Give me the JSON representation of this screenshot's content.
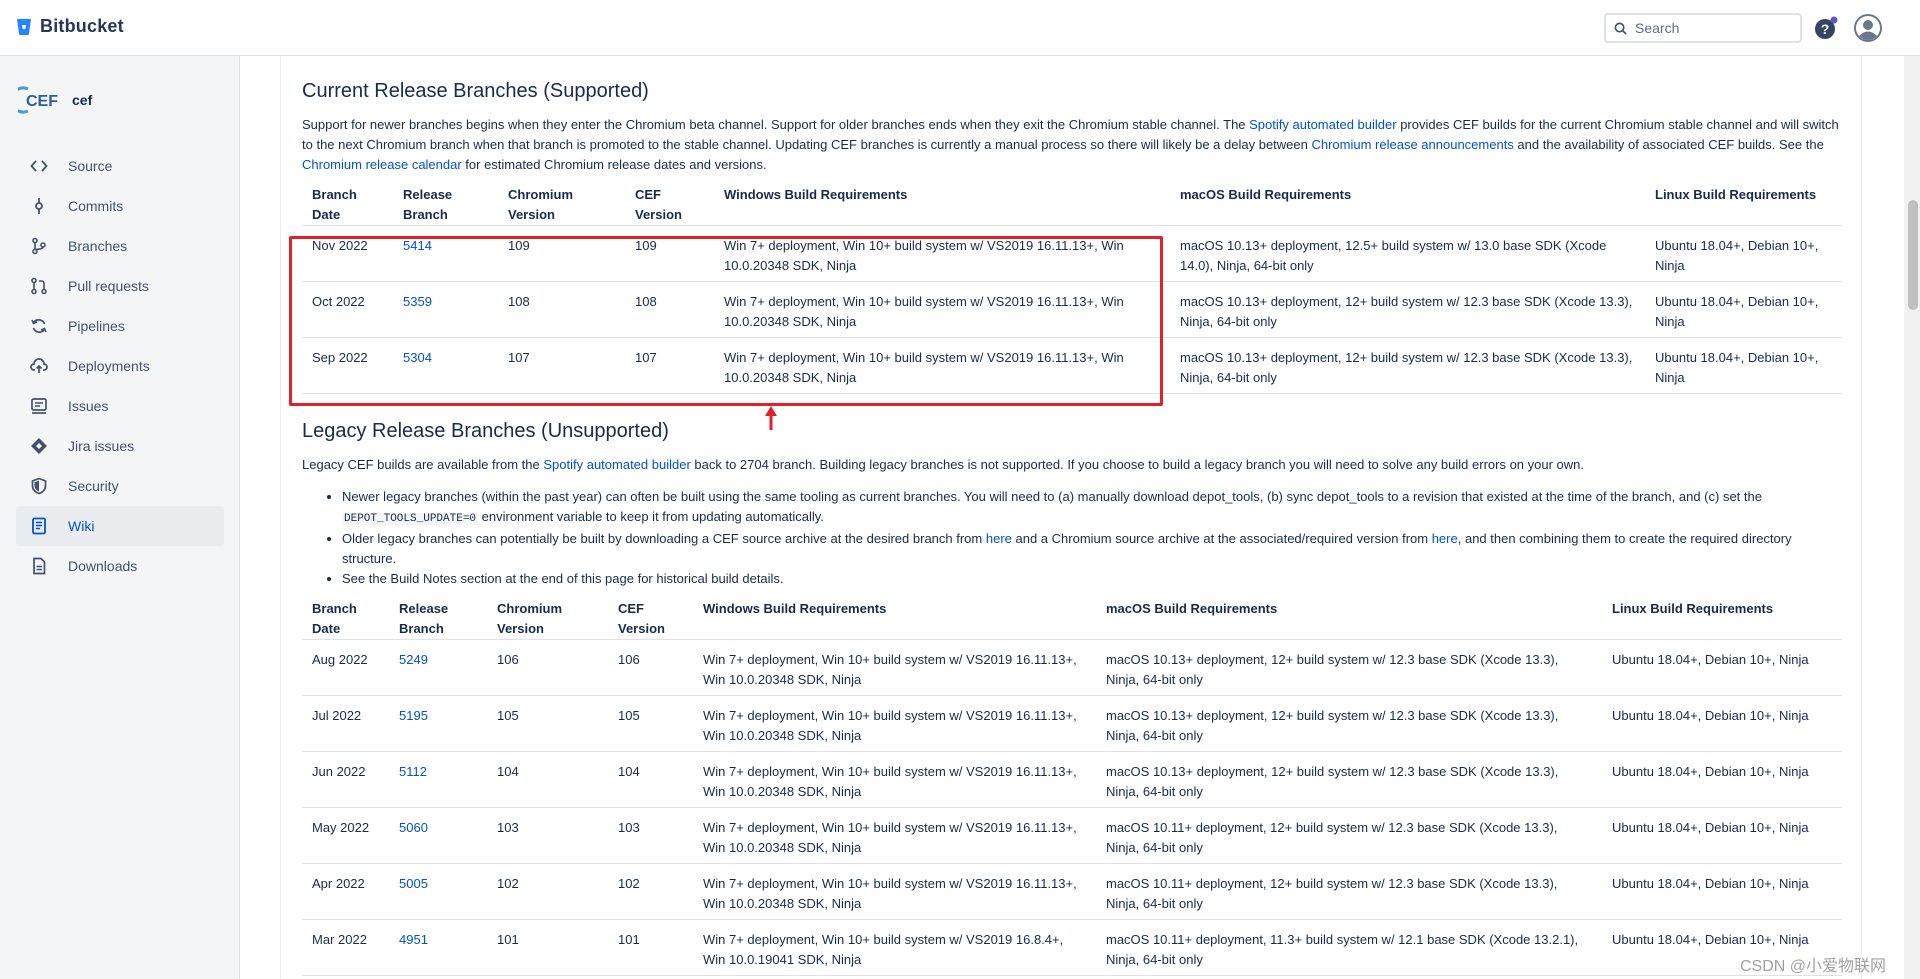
{
  "header": {
    "brand": "Bitbucket",
    "search_placeholder": "Search"
  },
  "sidebar": {
    "repo_name": "cef",
    "repo_logo": "CEF",
    "items": [
      {
        "label": "Source",
        "icon": "code-icon"
      },
      {
        "label": "Commits",
        "icon": "commit-icon"
      },
      {
        "label": "Branches",
        "icon": "branch-icon"
      },
      {
        "label": "Pull requests",
        "icon": "pull-request-icon"
      },
      {
        "label": "Pipelines",
        "icon": "pipelines-icon"
      },
      {
        "label": "Deployments",
        "icon": "deployments-icon"
      },
      {
        "label": "Issues",
        "icon": "issues-icon"
      },
      {
        "label": "Jira issues",
        "icon": "jira-icon"
      },
      {
        "label": "Security",
        "icon": "shield-icon"
      },
      {
        "label": "Wiki",
        "icon": "wiki-icon"
      },
      {
        "label": "Downloads",
        "icon": "downloads-icon"
      }
    ],
    "active": "Wiki"
  },
  "current": {
    "title": "Current Release Branches (Supported)",
    "desc": [
      {
        "t": "Support for newer branches begins when they enter the Chromium beta channel. Support for older branches ends when they exit the Chromium stable channel. The "
      },
      {
        "a": "Spotify automated builder"
      },
      {
        "t": " provides CEF builds for the current Chromium stable channel and will switch to the next Chromium branch when that branch is promoted to the stable channel. Updating CEF branches is currently a manual process so there will likely be a delay between "
      },
      {
        "a": "Chromium release announcements"
      },
      {
        "t": " and the availability of associated CEF builds. See the "
      },
      {
        "a": "Chromium release calendar"
      },
      {
        "t": " for estimated Chromium release dates and versions."
      }
    ],
    "headers": [
      "Branch Date",
      "Release Branch",
      "Chromium Version",
      "CEF Version",
      "Windows Build Requirements",
      "macOS Build Requirements",
      "Linux Build Requirements"
    ],
    "rows": [
      [
        "Nov 2022",
        "5414",
        "109",
        "109",
        "Win 7+ deployment, Win 10+ build system w/ VS2019 16.11.13+, Win 10.0.20348 SDK, Ninja",
        "macOS 10.13+ deployment, 12.5+ build system w/ 13.0 base SDK (Xcode 14.0), Ninja, 64-bit only",
        "Ubuntu 18.04+, Debian 10+, Ninja"
      ],
      [
        "Oct 2022",
        "5359",
        "108",
        "108",
        "Win 7+ deployment, Win 10+ build system w/ VS2019 16.11.13+, Win 10.0.20348 SDK, Ninja",
        "macOS 10.13+ deployment, 12+ build system w/ 12.3 base SDK (Xcode 13.3), Ninja, 64-bit only",
        "Ubuntu 18.04+, Debian 10+, Ninja"
      ],
      [
        "Sep 2022",
        "5304",
        "107",
        "107",
        "Win 7+ deployment, Win 10+ build system w/ VS2019 16.11.13+, Win 10.0.20348 SDK, Ninja",
        "macOS 10.13+ deployment, 12+ build system w/ 12.3 base SDK (Xcode 13.3), Ninja, 64-bit only",
        "Ubuntu 18.04+, Debian 10+, Ninja"
      ]
    ]
  },
  "legacy": {
    "title": "Legacy Release Branches (Unsupported)",
    "desc": [
      {
        "t": "Legacy CEF builds are available from the "
      },
      {
        "a": "Spotify automated builder"
      },
      {
        "t": " back to 2704 branch. Building legacy branches is not supported. If you choose to build a legacy branch you will need to solve any build errors on your own."
      }
    ],
    "bullets": [
      [
        {
          "t": "Newer legacy branches (within the past year) can often be built using the same tooling as current branches. You will need to (a) manually download depot_tools, (b) sync depot_tools to a revision that existed at the time of the branch, and (c) set the "
        },
        {
          "c": "DEPOT_TOOLS_UPDATE=0"
        },
        {
          "t": " environment variable to keep it from updating automatically."
        }
      ],
      [
        {
          "t": "Older legacy branches can potentially be built by downloading a CEF source archive at the desired branch from "
        },
        {
          "a": "here"
        },
        {
          "t": " and a Chromium source archive at the associated/required version from "
        },
        {
          "a": "here"
        },
        {
          "t": ", and then combining them to create the required directory structure."
        }
      ],
      [
        {
          "t": "See the Build Notes section at the end of this page for historical build details."
        }
      ]
    ],
    "headers": [
      "Branch Date",
      "Release Branch",
      "Chromium Version",
      "CEF Version",
      "Windows Build Requirements",
      "macOS Build Requirements",
      "Linux Build Requirements"
    ],
    "rows": [
      [
        "Aug 2022",
        "5249",
        "106",
        "106",
        "Win 7+ deployment, Win 10+ build system w/ VS2019 16.11.13+, Win 10.0.20348 SDK, Ninja",
        "macOS 10.13+ deployment, 12+ build system w/ 12.3 base SDK (Xcode 13.3), Ninja, 64-bit only",
        "Ubuntu 18.04+, Debian 10+, Ninja"
      ],
      [
        "Jul 2022",
        "5195",
        "105",
        "105",
        "Win 7+ deployment, Win 10+ build system w/ VS2019 16.11.13+, Win 10.0.20348 SDK, Ninja",
        "macOS 10.13+ deployment, 12+ build system w/ 12.3 base SDK (Xcode 13.3), Ninja, 64-bit only",
        "Ubuntu 18.04+, Debian 10+, Ninja"
      ],
      [
        "Jun 2022",
        "5112",
        "104",
        "104",
        "Win 7+ deployment, Win 10+ build system w/ VS2019 16.11.13+, Win 10.0.20348 SDK, Ninja",
        "macOS 10.13+ deployment, 12+ build system w/ 12.3 base SDK (Xcode 13.3), Ninja, 64-bit only",
        "Ubuntu 18.04+, Debian 10+, Ninja"
      ],
      [
        "May 2022",
        "5060",
        "103",
        "103",
        "Win 7+ deployment, Win 10+ build system w/ VS2019 16.11.13+, Win 10.0.20348 SDK, Ninja",
        "macOS 10.11+ deployment, 12+ build system w/ 12.3 base SDK (Xcode 13.3), Ninja, 64-bit only",
        "Ubuntu 18.04+, Debian 10+, Ninja"
      ],
      [
        "Apr 2022",
        "5005",
        "102",
        "102",
        "Win 7+ deployment, Win 10+ build system w/ VS2019 16.11.13+, Win 10.0.20348 SDK, Ninja",
        "macOS 10.11+ deployment, 12+ build system w/ 12.3 base SDK (Xcode 13.3), Ninja, 64-bit only",
        "Ubuntu 18.04+, Debian 10+, Ninja"
      ],
      [
        "Mar 2022",
        "4951",
        "101",
        "101",
        "Win 7+ deployment, Win 10+ build system w/ VS2019 16.8.4+, Win 10.0.19041 SDK, Ninja",
        "macOS 10.11+ deployment, 11.3+ build system w/ 12.1 base SDK (Xcode 13.2.1), Ninja, 64-bit only",
        "Ubuntu 18.04+, Debian 10+, Ninja"
      ]
    ]
  },
  "watermark": "CSDN @小爱物联网"
}
